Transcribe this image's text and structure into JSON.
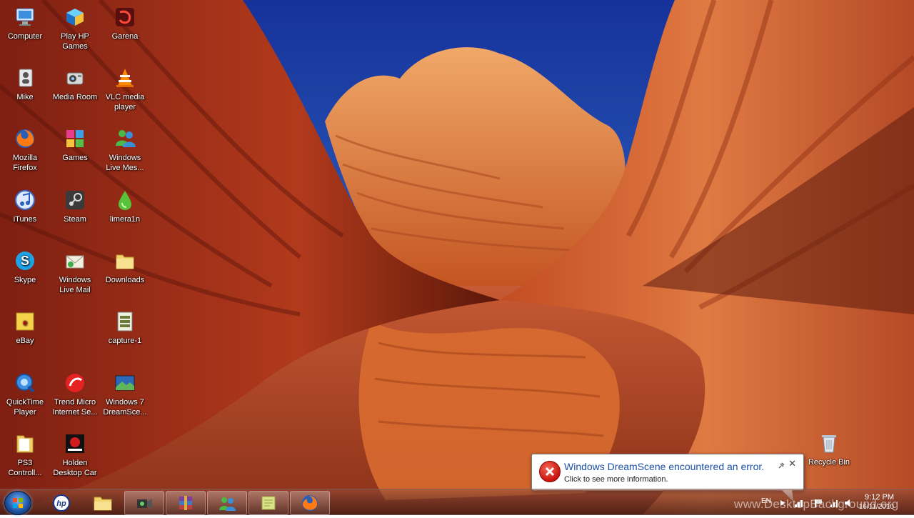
{
  "desktop": {
    "icons": [
      {
        "label": "Computer",
        "icon": "computer-icon"
      },
      {
        "label": "Play HP\nGames",
        "icon": "hp-games-icon"
      },
      {
        "label": "Garena",
        "icon": "garena-icon"
      },
      {
        "label": "Mike",
        "icon": "user-folder-icon"
      },
      {
        "label": "Media Room",
        "icon": "media-room-icon"
      },
      {
        "label": "VLC media\nplayer",
        "icon": "vlc-icon"
      },
      {
        "label": "Mozilla\nFirefox",
        "icon": "firefox-icon"
      },
      {
        "label": "Games",
        "icon": "games-icon"
      },
      {
        "label": "Windows\nLive Mes...",
        "icon": "messenger-icon"
      },
      {
        "label": "iTunes",
        "icon": "itunes-icon"
      },
      {
        "label": "Steam",
        "icon": "steam-icon"
      },
      {
        "label": "limera1n",
        "icon": "limera1n-icon"
      },
      {
        "label": "Skype",
        "icon": "skype-icon"
      },
      {
        "label": "Windows\nLive Mail",
        "icon": "live-mail-icon"
      },
      {
        "label": "Downloads",
        "icon": "folder-icon"
      },
      {
        "label": "eBay",
        "icon": "ebay-icon"
      },
      {
        "label": "capture-1",
        "icon": "video-file-icon"
      },
      {
        "label": "QuickTime\nPlayer",
        "icon": "quicktime-icon"
      },
      {
        "label": "Trend Micro\nInternet Se...",
        "icon": "trend-micro-icon"
      },
      {
        "label": "Windows 7\nDreamSce...",
        "icon": "dreamscene-icon"
      },
      {
        "label": "PS3\nControll...",
        "icon": "ps3-folder-icon"
      },
      {
        "label": "Holden\nDesktop Car",
        "icon": "holden-icon"
      }
    ],
    "recycle_bin": {
      "label": "Recycle Bin",
      "icon": "recycle-bin-icon"
    }
  },
  "notification": {
    "title": "Windows DreamScene encountered an error.",
    "subtitle": "Click to see more information.",
    "close_glyph": "✕",
    "icon": "error-icon"
  },
  "taskbar": {
    "start": "windows-start-orb",
    "pinned": [
      "hp-icon",
      "explorer-icon",
      "video-capture-icon",
      "winrar-icon",
      "messenger-icon",
      "sticky-notes-icon",
      "firefox-icon"
    ],
    "tray": {
      "language": "EN",
      "time": "9:12 PM",
      "date": "16/11/2010"
    }
  },
  "watermark": "www.DesktopBackground.org",
  "colors": {
    "error_red": "#c8120c",
    "balloon_title_blue": "#1b4fa8",
    "sky_blue": "#1e4fb0",
    "rock_orange": "#d9592a"
  }
}
